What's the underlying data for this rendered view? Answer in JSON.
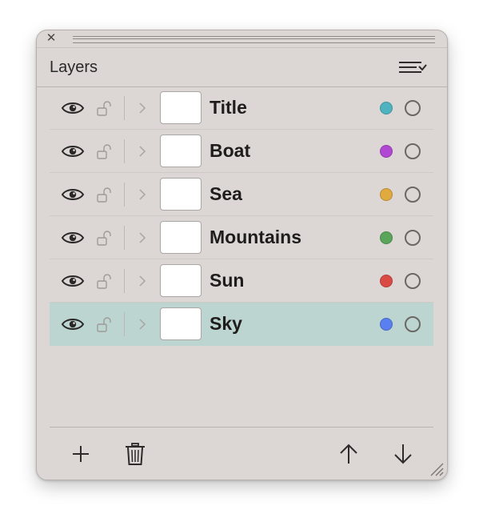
{
  "panel": {
    "title": "Layers",
    "close_icon": "✕"
  },
  "layers": [
    {
      "name": "Title",
      "color": "#4fb3bf",
      "selected": false
    },
    {
      "name": "Boat",
      "color": "#b148d4",
      "selected": false
    },
    {
      "name": "Sea",
      "color": "#e0aa3e",
      "selected": false
    },
    {
      "name": "Mountains",
      "color": "#5aa55a",
      "selected": false
    },
    {
      "name": "Sun",
      "color": "#d94a45",
      "selected": false
    },
    {
      "name": "Sky",
      "color": "#5a7ff0",
      "selected": true
    }
  ],
  "icons": {
    "header_menu": "sort-menu-icon",
    "visibility": "eye-icon",
    "lock": "lock-open-icon",
    "expand": "chevron-right-icon",
    "add": "plus-icon",
    "delete": "trash-icon",
    "move_up": "arrow-up-icon",
    "move_down": "arrow-down-icon",
    "resize": "resize-grip-icon"
  },
  "colors": {
    "panel_bg": "#dcd7d5",
    "selected_row_bg": "#bcd5d0"
  }
}
